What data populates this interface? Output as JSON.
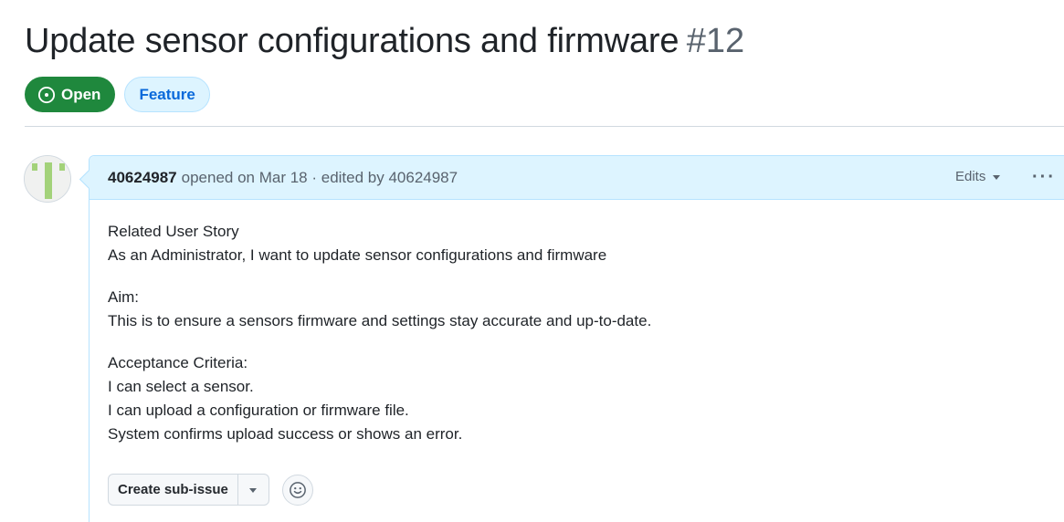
{
  "issue": {
    "title": "Update sensor configurations and firmware",
    "number": "#12",
    "state": "Open",
    "label": "Feature"
  },
  "comment": {
    "author": "40624987",
    "meta": "opened on Mar 18 · edited by 40624987",
    "edits_label": "Edits",
    "more_icon": "kebab-horizontal-icon",
    "body": {
      "story_heading": "Related User Story",
      "story_text": "As an Administrator, I want to update sensor configurations and firmware",
      "aim_heading": "Aim:",
      "aim_text": "This is to ensure a sensors firmware and settings stay accurate and up-to-date.",
      "criteria_heading": "Acceptance Criteria:",
      "criteria": [
        "I can select a sensor.",
        "I can upload a configuration or firmware file.",
        "System confirms upload success or shows an error."
      ]
    },
    "actions": {
      "create_sub_issue": "Create sub-issue",
      "emoji_icon": "smiley-icon"
    }
  },
  "colors": {
    "open_green": "#1f883d",
    "label_blue": "#0969da",
    "header_bg": "#ddf4ff"
  }
}
